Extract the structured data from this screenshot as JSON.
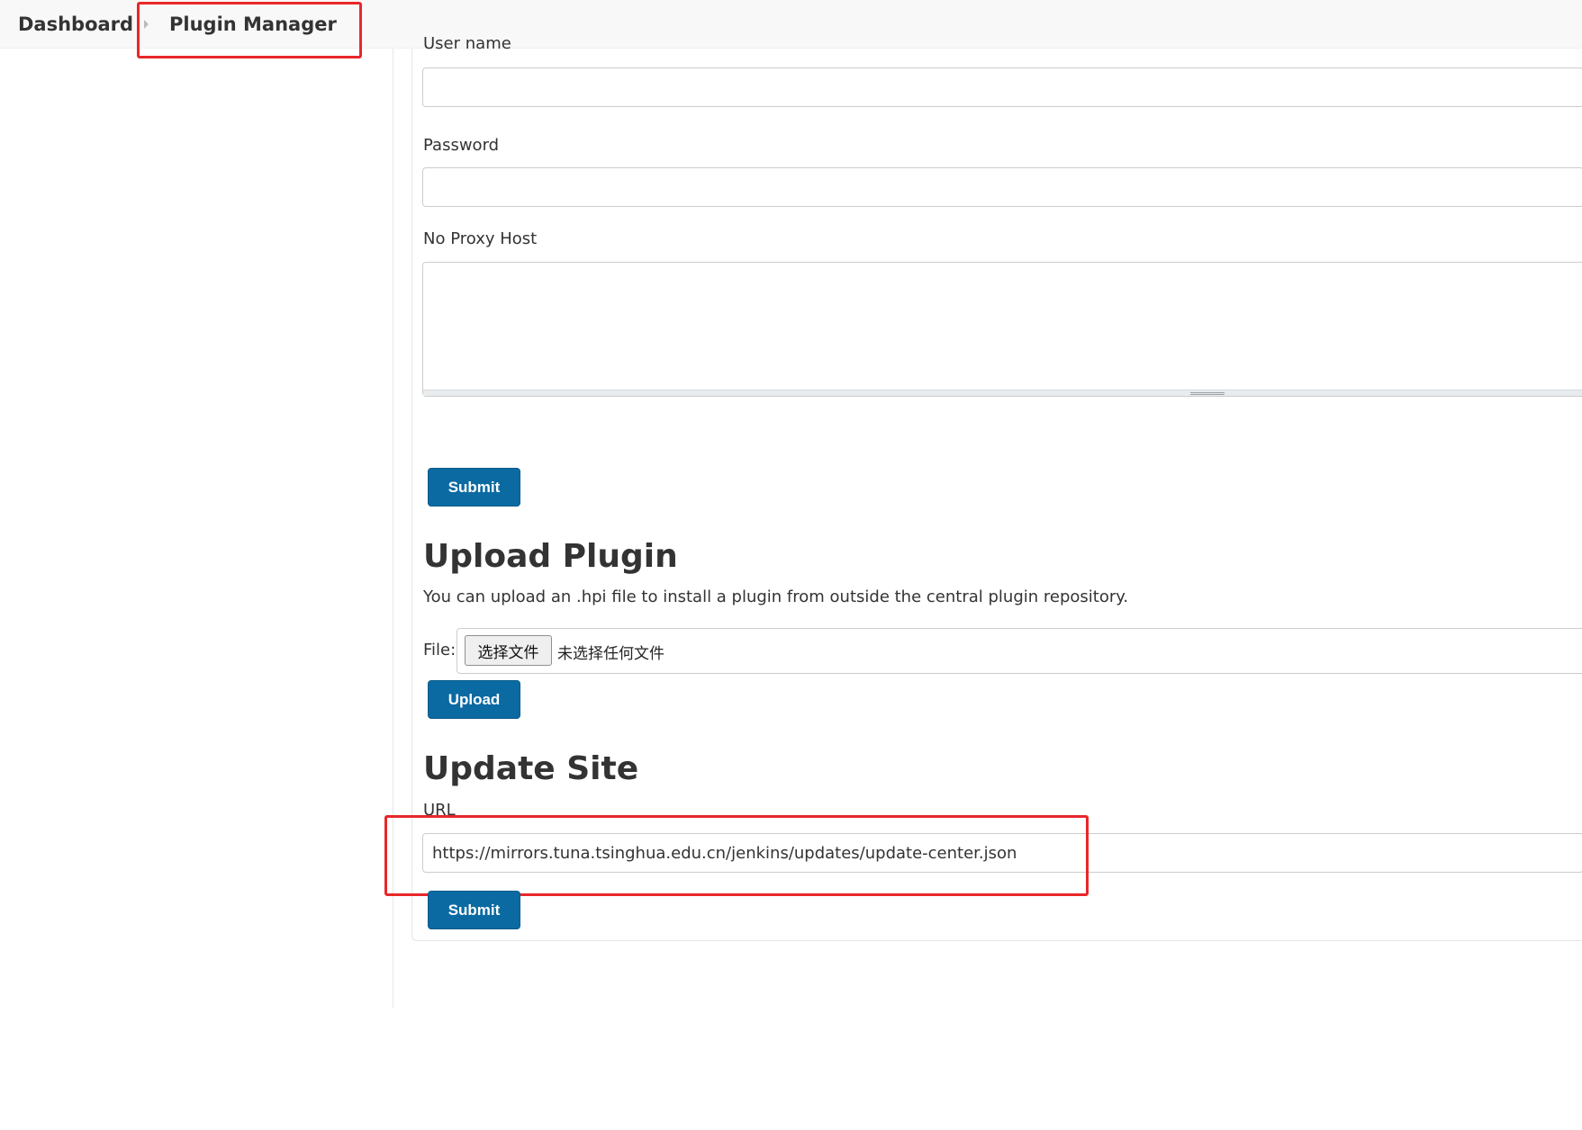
{
  "breadcrumb": {
    "dashboard": "Dashboard",
    "plugin_manager": "Plugin Manager"
  },
  "proxy": {
    "username_label": "User name",
    "username_value": "",
    "password_label": "Password",
    "password_value": "",
    "no_proxy_label": "No Proxy Host",
    "no_proxy_value": "",
    "submit_label": "Submit"
  },
  "upload": {
    "title": "Upload Plugin",
    "description": "You can upload an .hpi file to install a plugin from outside the central plugin repository.",
    "file_label": "File:",
    "choose_file_label": "选择文件",
    "no_file_text": "未选择任何文件",
    "upload_label": "Upload"
  },
  "update_site": {
    "title": "Update Site",
    "url_label": "URL",
    "url_value": "https://mirrors.tuna.tsinghua.edu.cn/jenkins/updates/update-center.json",
    "submit_label": "Submit"
  },
  "colors": {
    "button": "#0b6aa2",
    "highlight": "#e8272a",
    "breadcrumb_bg": "#f8f8f8"
  }
}
